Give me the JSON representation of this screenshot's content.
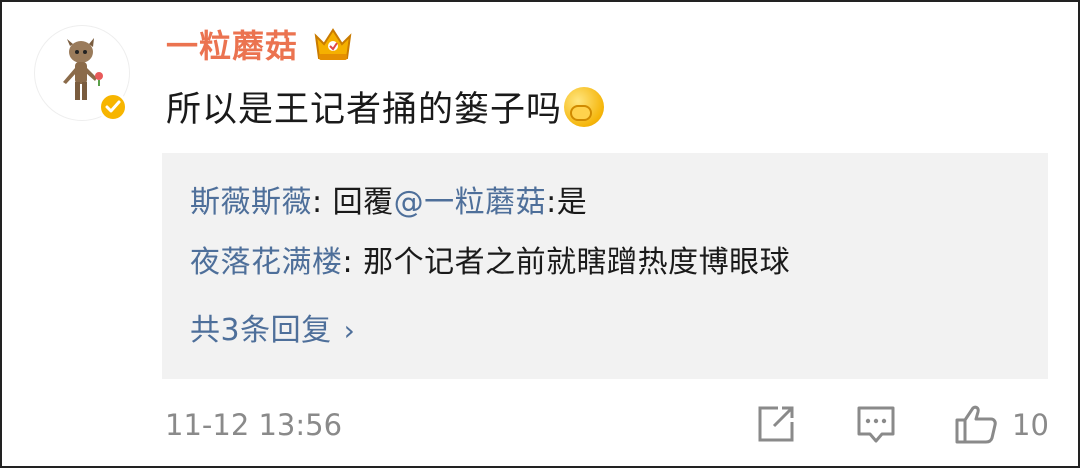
{
  "comment": {
    "username": "一粒蘑菇",
    "text": "所以是王记者捅的篓子吗",
    "emoji_icon": "cry-laugh-emoji-icon",
    "vip_badge_icon": "crown-vip-icon",
    "verified_icon": "verified-badge-icon",
    "timestamp": "11-12 13:56",
    "like_count": "10"
  },
  "replies": [
    {
      "name": "斯薇斯薇",
      "colon": ": ",
      "prefix": "回覆",
      "mention": "@一粒蘑菇",
      "suffix": ":是"
    },
    {
      "name": "夜落花满楼",
      "colon": ": ",
      "text": "那个记者之前就瞎蹭热度博眼球"
    }
  ],
  "more_replies": {
    "label": "共3条回复",
    "chevron": "›"
  },
  "actions": {
    "share_icon": "share-icon",
    "comment_icon": "comment-icon",
    "like_icon": "thumbs-up-icon"
  },
  "colors": {
    "username": "#eb7350",
    "link": "#4e6f9a",
    "meta": "#8a8a8a",
    "reply_bg": "#f2f2f2"
  }
}
